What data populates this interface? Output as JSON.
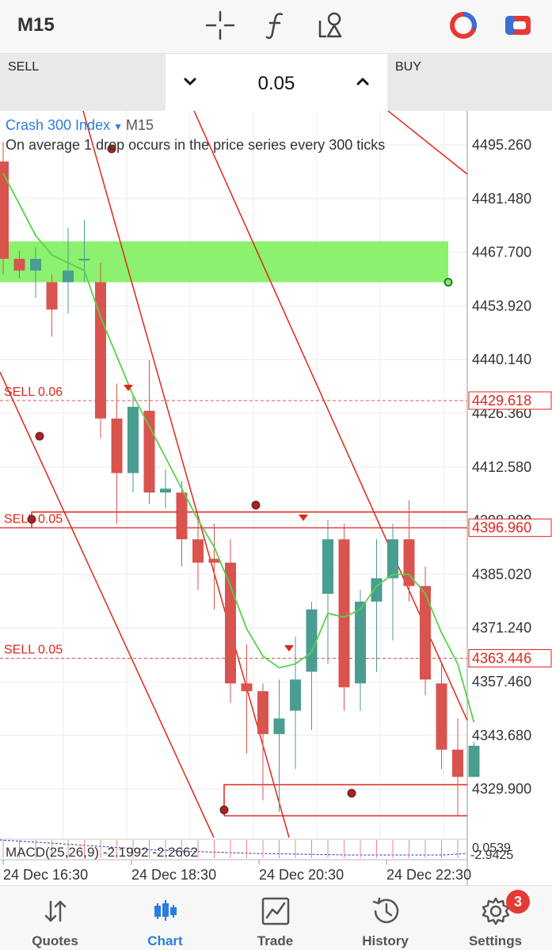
{
  "toolbar": {
    "timeframe": "M15",
    "icons": [
      "crosshair-icon",
      "function-icon",
      "objects-icon",
      "chart-type-icon",
      "color-scheme-icon"
    ]
  },
  "trade_panel": {
    "sell_label": "SELL",
    "buy_label": "BUY",
    "volume": "0.05"
  },
  "chart": {
    "symbol": "Crash 300 Index",
    "timeframe": "M15",
    "description": "On average 1 drop occurs in the price series every 300 ticks",
    "indicator_label": "MACD(25,26,9) -2.1992 -2.2662",
    "indicator_axis": [
      "0.0539",
      "-2.9425"
    ],
    "colors": {
      "bullish": "#4a9d91",
      "bearish": "#d9534f",
      "ma_line": "#58d14b",
      "zone": "#7ef05e",
      "lines": "#e0261b",
      "macd": "#3030c0"
    }
  },
  "chart_data": {
    "type": "candlestick",
    "price_axis_ticks": [
      "4495.260",
      "4481.480",
      "4467.700",
      "4453.920",
      "4440.140",
      "4426.360",
      "4412.580",
      "4398.800",
      "4385.020",
      "4371.240",
      "4357.460",
      "4343.680",
      "4329.900"
    ],
    "time_axis_labels": [
      "24 Dec 16:30",
      "24 Dec 18:30",
      "24 Dec 20:30",
      "24 Dec 22:30"
    ],
    "ylim": [
      4322,
      4500
    ],
    "orders": [
      {
        "label": "SELL 0.06",
        "price": 4429.618,
        "price_label": "4429.618"
      },
      {
        "label": "SELL 0.05",
        "price": 4396.96,
        "price_label": "4396.960"
      },
      {
        "label": "SELL 0.05",
        "price": 4363.446,
        "price_label": "4363.446"
      }
    ],
    "candles": [
      {
        "o": 4491,
        "c": 4466,
        "h": 4496,
        "l": 4462
      },
      {
        "o": 4466,
        "c": 4463,
        "h": 4468,
        "l": 4461
      },
      {
        "o": 4463,
        "c": 4466,
        "h": 4469,
        "l": 4456
      },
      {
        "o": 4460,
        "c": 4453,
        "h": 4462,
        "l": 4446
      },
      {
        "o": 4460,
        "c": 4463,
        "h": 4474,
        "l": 4452
      },
      {
        "o": 4466,
        "c": 4466,
        "h": 4476,
        "l": 4460
      },
      {
        "o": 4460,
        "c": 4425,
        "h": 4465,
        "l": 4420
      },
      {
        "o": 4425,
        "c": 4411,
        "h": 4434,
        "l": 4398
      },
      {
        "o": 4411,
        "c": 4428,
        "h": 4431,
        "l": 4406
      },
      {
        "o": 4427,
        "c": 4406,
        "h": 4440,
        "l": 4403
      },
      {
        "o": 4406,
        "c": 4407,
        "h": 4412,
        "l": 4402
      },
      {
        "o": 4406,
        "c": 4394,
        "h": 4409,
        "l": 4387
      },
      {
        "o": 4394,
        "c": 4388,
        "h": 4400,
        "l": 4381
      },
      {
        "o": 4389,
        "c": 4388,
        "h": 4398,
        "l": 4376
      },
      {
        "o": 4388,
        "c": 4357,
        "h": 4394,
        "l": 4352
      },
      {
        "o": 4357,
        "c": 4355,
        "h": 4367,
        "l": 4339
      },
      {
        "o": 4355,
        "c": 4344,
        "h": 4357,
        "l": 4327
      },
      {
        "o": 4344,
        "c": 4348,
        "h": 4358,
        "l": 4324
      },
      {
        "o": 4350,
        "c": 4358,
        "h": 4369,
        "l": 4335
      },
      {
        "o": 4360,
        "c": 4376,
        "h": 4378,
        "l": 4345
      },
      {
        "o": 4380,
        "c": 4394,
        "h": 4399,
        "l": 4362
      },
      {
        "o": 4394,
        "c": 4356,
        "h": 4398,
        "l": 4350
      },
      {
        "o": 4357,
        "c": 4378,
        "h": 4381,
        "l": 4350
      },
      {
        "o": 4378,
        "c": 4384,
        "h": 4394,
        "l": 4360
      },
      {
        "o": 4384,
        "c": 4394,
        "h": 4398,
        "l": 4368
      },
      {
        "o": 4394,
        "c": 4382,
        "h": 4404,
        "l": 4378
      },
      {
        "o": 4382,
        "c": 4358,
        "h": 4387,
        "l": 4354
      },
      {
        "o": 4357,
        "c": 4340,
        "h": 4362,
        "l": 4335
      },
      {
        "o": 4340,
        "c": 4333,
        "h": 4348,
        "l": 4323
      },
      {
        "o": 4333,
        "c": 4341,
        "h": 4342,
        "l": 4333
      }
    ],
    "moving_average": [
      4488,
      4480,
      4472,
      4467,
      4465,
      4463,
      4451,
      4441,
      4431,
      4423,
      4415,
      4407,
      4399,
      4392,
      4382,
      4371,
      4364,
      4361,
      4362,
      4365,
      4375,
      4374,
      4376,
      4382,
      4385,
      4385,
      4380,
      4370,
      4362,
      4347
    ]
  },
  "nav": {
    "items": [
      {
        "label": "Quotes",
        "icon": "quotes-icon"
      },
      {
        "label": "Chart",
        "icon": "chart-icon"
      },
      {
        "label": "Trade",
        "icon": "trade-icon"
      },
      {
        "label": "History",
        "icon": "history-icon"
      },
      {
        "label": "Settings",
        "icon": "settings-icon"
      }
    ],
    "settings_badge": "3",
    "active_color": "#2a7de1"
  }
}
